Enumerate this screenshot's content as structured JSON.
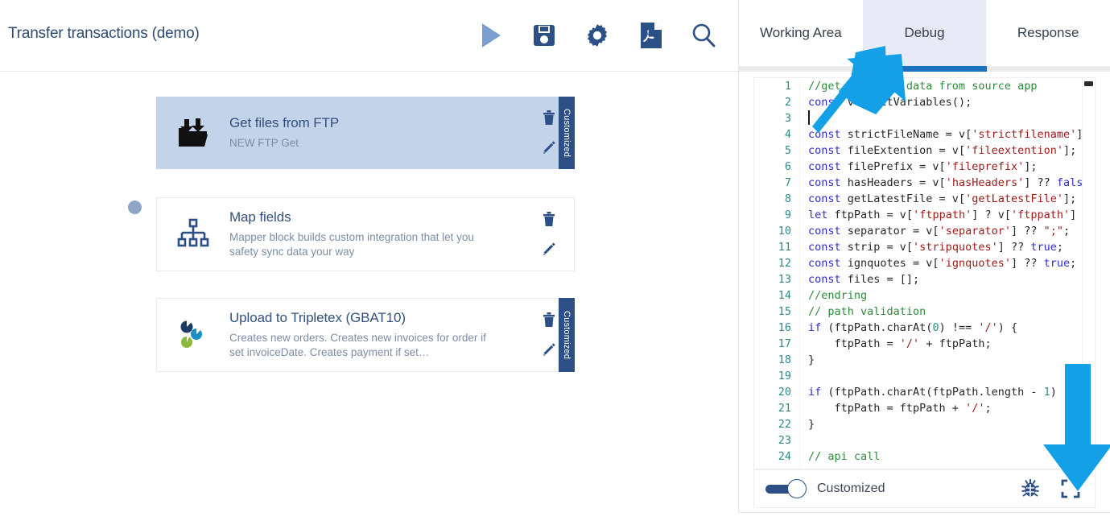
{
  "app": {
    "title": "Transfer transactions (demo)",
    "accent_color": "#2c5085",
    "selected_card_bg": "#c3d3ea",
    "tab_active_bg": "#e8ebf7",
    "tab_underline_color": "#1b72bf",
    "annotation_arrow_color": "#14a0e6"
  },
  "header": {
    "actions": [
      {
        "name": "run-icon",
        "label": "Run",
        "glyph": "play"
      },
      {
        "name": "save-icon",
        "label": "Save",
        "glyph": "floppy"
      },
      {
        "name": "settings-icon",
        "label": "Settings",
        "glyph": "gear"
      },
      {
        "name": "export-pdf-icon",
        "label": "Export PDF",
        "glyph": "pdf"
      },
      {
        "name": "search-icon",
        "label": "Search",
        "glyph": "magnifier"
      }
    ]
  },
  "flow": {
    "cards": [
      {
        "title": "Get files from FTP",
        "description": "NEW FTP Get",
        "icon": "ftp-folder-icon",
        "badge": "Customized",
        "has_badge": true,
        "selected": true,
        "delete_label": "Delete",
        "edit_label": "Edit"
      },
      {
        "title": "Map fields",
        "description": "Mapper block builds custom integration that let you safety sync data your way",
        "icon": "sitemap-icon",
        "badge": "",
        "has_badge": false,
        "selected": false,
        "delete_label": "Delete",
        "edit_label": "Edit"
      },
      {
        "title": "Upload to Tripletex (GBAT10)",
        "description": "Creates new orders. Creates new invoices for order if set invoiceDate. Creates payment if set…",
        "icon": "tripletex-icon",
        "badge": "Customized",
        "has_badge": true,
        "selected": false,
        "delete_label": "Delete",
        "edit_label": "Edit"
      }
    ]
  },
  "panel": {
    "tabs": [
      {
        "label": "Working Area",
        "active": false
      },
      {
        "label": "Debug",
        "active": true
      },
      {
        "label": "Response",
        "active": false
      }
    ],
    "footer": {
      "toggle_label": "Customized",
      "toggle_on": true,
      "icons": [
        {
          "name": "debug-bug-icon",
          "label": "Debug"
        },
        {
          "name": "fullscreen-icon",
          "label": "Fullscreen"
        }
      ]
    }
  },
  "editor": {
    "lines": [
      {
        "n": "1",
        "tokens": [
          {
            "c": "com",
            "t": "//get required data from source app"
          }
        ]
      },
      {
        "n": "2",
        "tokens": [
          {
            "c": "kw",
            "t": "const"
          },
          {
            "c": "pln",
            "t": " v = getVariables();"
          }
        ]
      },
      {
        "n": "3",
        "tokens": [
          {
            "c": "pln",
            "t": ""
          }
        ]
      },
      {
        "n": "4",
        "tokens": [
          {
            "c": "kw",
            "t": "const"
          },
          {
            "c": "pln",
            "t": " strictFileName = v["
          },
          {
            "c": "str",
            "t": "'strictfilename'"
          },
          {
            "c": "pln",
            "t": "];"
          }
        ]
      },
      {
        "n": "5",
        "tokens": [
          {
            "c": "kw",
            "t": "const"
          },
          {
            "c": "pln",
            "t": " fileExtention = v["
          },
          {
            "c": "str",
            "t": "'fileextention'"
          },
          {
            "c": "pln",
            "t": "];"
          }
        ]
      },
      {
        "n": "6",
        "tokens": [
          {
            "c": "kw",
            "t": "const"
          },
          {
            "c": "pln",
            "t": " filePrefix = v["
          },
          {
            "c": "str",
            "t": "'fileprefix'"
          },
          {
            "c": "pln",
            "t": "];"
          }
        ]
      },
      {
        "n": "7",
        "tokens": [
          {
            "c": "kw",
            "t": "const"
          },
          {
            "c": "pln",
            "t": " hasHeaders = v["
          },
          {
            "c": "str",
            "t": "'hasHeaders'"
          },
          {
            "c": "pln",
            "t": "] ?? "
          },
          {
            "c": "kw",
            "t": "false"
          },
          {
            "c": "pln",
            "t": ";"
          }
        ]
      },
      {
        "n": "8",
        "tokens": [
          {
            "c": "kw",
            "t": "const"
          },
          {
            "c": "pln",
            "t": " getLatestFile = v["
          },
          {
            "c": "str",
            "t": "'getLatestFile'"
          },
          {
            "c": "pln",
            "t": "];"
          }
        ]
      },
      {
        "n": "9",
        "tokens": [
          {
            "c": "kw",
            "t": "let"
          },
          {
            "c": "pln",
            "t": " ftpPath = v["
          },
          {
            "c": "str",
            "t": "'ftppath'"
          },
          {
            "c": "pln",
            "t": "] ? v["
          },
          {
            "c": "str",
            "t": "'ftppath'"
          },
          {
            "c": "pln",
            "t": "] : "
          }
        ]
      },
      {
        "n": "10",
        "tokens": [
          {
            "c": "kw",
            "t": "const"
          },
          {
            "c": "pln",
            "t": " separator = v["
          },
          {
            "c": "str",
            "t": "'separator'"
          },
          {
            "c": "pln",
            "t": "] ?? "
          },
          {
            "c": "str",
            "t": "\";\""
          },
          {
            "c": "pln",
            "t": ";"
          }
        ]
      },
      {
        "n": "11",
        "tokens": [
          {
            "c": "kw",
            "t": "const"
          },
          {
            "c": "pln",
            "t": " strip = v["
          },
          {
            "c": "str",
            "t": "'stripquotes'"
          },
          {
            "c": "pln",
            "t": "] ?? "
          },
          {
            "c": "kw",
            "t": "true"
          },
          {
            "c": "pln",
            "t": ";"
          }
        ]
      },
      {
        "n": "12",
        "tokens": [
          {
            "c": "kw",
            "t": "const"
          },
          {
            "c": "pln",
            "t": " ignquotes = v["
          },
          {
            "c": "str",
            "t": "'ignquotes'"
          },
          {
            "c": "pln",
            "t": "] ?? "
          },
          {
            "c": "kw",
            "t": "true"
          },
          {
            "c": "pln",
            "t": ";"
          }
        ]
      },
      {
        "n": "13",
        "tokens": [
          {
            "c": "kw",
            "t": "const"
          },
          {
            "c": "pln",
            "t": " files = [];"
          }
        ]
      },
      {
        "n": "14",
        "tokens": [
          {
            "c": "com",
            "t": "//endring"
          }
        ]
      },
      {
        "n": "15",
        "tokens": [
          {
            "c": "com",
            "t": "// path validation"
          }
        ]
      },
      {
        "n": "16",
        "tokens": [
          {
            "c": "kw",
            "t": "if"
          },
          {
            "c": "pln",
            "t": " (ftpPath.charAt("
          },
          {
            "c": "num",
            "t": "0"
          },
          {
            "c": "pln",
            "t": ") !== "
          },
          {
            "c": "str",
            "t": "'/'"
          },
          {
            "c": "pln",
            "t": ") {"
          }
        ]
      },
      {
        "n": "17",
        "tokens": [
          {
            "c": "pln",
            "t": "    ftpPath = "
          },
          {
            "c": "str",
            "t": "'/'"
          },
          {
            "c": "pln",
            "t": " + ftpPath;"
          }
        ]
      },
      {
        "n": "18",
        "tokens": [
          {
            "c": "pln",
            "t": "}"
          }
        ]
      },
      {
        "n": "19",
        "tokens": [
          {
            "c": "pln",
            "t": ""
          }
        ]
      },
      {
        "n": "20",
        "tokens": [
          {
            "c": "kw",
            "t": "if"
          },
          {
            "c": "pln",
            "t": " (ftpPath.charAt(ftpPath.length - "
          },
          {
            "c": "num",
            "t": "1"
          },
          {
            "c": "pln",
            "t": ") !== "
          }
        ]
      },
      {
        "n": "21",
        "tokens": [
          {
            "c": "pln",
            "t": "    ftpPath = ftpPath + "
          },
          {
            "c": "str",
            "t": "'/'"
          },
          {
            "c": "pln",
            "t": ";"
          }
        ]
      },
      {
        "n": "22",
        "tokens": [
          {
            "c": "pln",
            "t": "}"
          }
        ]
      },
      {
        "n": "23",
        "tokens": [
          {
            "c": "pln",
            "t": ""
          }
        ]
      },
      {
        "n": "24",
        "tokens": [
          {
            "c": "com",
            "t": "// api call"
          }
        ]
      }
    ]
  }
}
